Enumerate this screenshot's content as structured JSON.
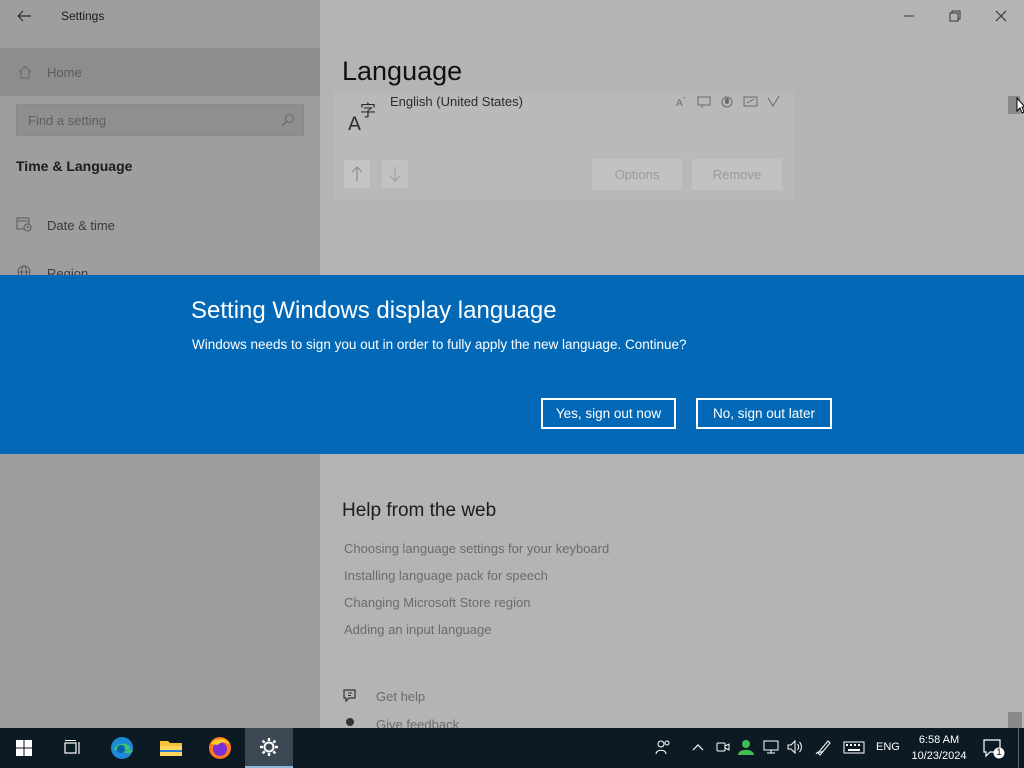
{
  "window": {
    "app_title": "Settings",
    "back_icon": "back-arrow-icon",
    "controls": [
      "minimize-icon",
      "restore-icon",
      "close-icon"
    ]
  },
  "sidebar": {
    "home_label": "Home",
    "search_placeholder": "Find a setting",
    "section_title": "Time & Language",
    "items": [
      {
        "label": "Date & time",
        "icon": "calendar-clock-icon"
      },
      {
        "label": "Region",
        "icon": "globe-icon"
      }
    ]
  },
  "main": {
    "page_title": "Language",
    "language_entry": {
      "name": "English (United States)",
      "features": [
        "display-language-icon",
        "text-to-speech-icon",
        "speech-recognition-icon",
        "handwriting-icon",
        "keyboard-icon"
      ]
    },
    "options_label": "Options",
    "remove_label": "Remove",
    "help": {
      "title": "Help from the web",
      "links": [
        "Choosing language settings for your keyboard",
        "Installing language pack for speech",
        "Changing Microsoft Store region",
        "Adding an input language"
      ],
      "get_help_label": "Get help",
      "feedback_label": "Give feedback"
    }
  },
  "dialog": {
    "title": "Setting Windows display language",
    "message": "Windows needs to sign you out in order to fully apply the new language. Continue?",
    "yes_label": "Yes, sign out now",
    "no_label": "No, sign out later"
  },
  "taskbar": {
    "apps": [
      "start-icon",
      "task-view-icon",
      "edge-icon",
      "file-explorer-icon",
      "firefox-icon",
      "settings-icon"
    ],
    "active_app": "settings-icon",
    "language": "ENG",
    "time": "6:58 AM",
    "date": "10/23/2024",
    "notification_count": "1"
  },
  "colors": {
    "dialog_blue": "#0369b7",
    "taskbar": "#0c1a24"
  }
}
